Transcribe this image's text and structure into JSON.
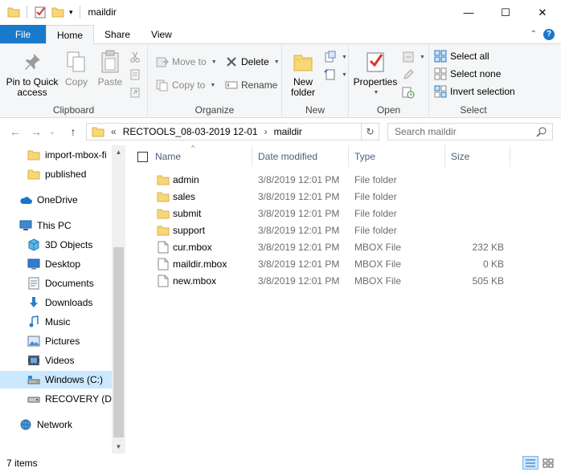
{
  "window": {
    "title": "maildir",
    "minimize": "—",
    "maximize": "☐",
    "close": "✕"
  },
  "tabs": [
    {
      "label": "File"
    },
    {
      "label": "Home"
    },
    {
      "label": "Share"
    },
    {
      "label": "View"
    }
  ],
  "ribbon": {
    "clipboard": {
      "label": "Clipboard",
      "pin_line1": "Pin to Quick",
      "pin_line2": "access",
      "copy": "Copy",
      "paste": "Paste"
    },
    "organize": {
      "label": "Organize",
      "move_to": "Move to",
      "copy_to": "Copy to",
      "delete": "Delete",
      "rename": "Rename"
    },
    "new": {
      "label": "New",
      "new_folder_line1": "New",
      "new_folder_line2": "folder"
    },
    "open": {
      "label": "Open",
      "properties": "Properties"
    },
    "select": {
      "label": "Select",
      "select_all": "Select all",
      "select_none": "Select none",
      "invert_selection": "Invert selection"
    }
  },
  "address": {
    "overflow": "«",
    "crumb1": "RECTOOLS_08-03-2019 12-01",
    "sep": "›",
    "crumb2": "maildir"
  },
  "search": {
    "placeholder": "Search maildir"
  },
  "nav": [
    {
      "label": "import-mbox-fi",
      "icon": "folder-icon"
    },
    {
      "label": "published",
      "icon": "folder-icon"
    },
    {
      "label": "OneDrive",
      "icon": "cloud-icon"
    },
    {
      "label": "This PC",
      "icon": "computer-icon"
    },
    {
      "label": "3D Objects",
      "icon": "cube-icon"
    },
    {
      "label": "Desktop",
      "icon": "desktop-icon"
    },
    {
      "label": "Documents",
      "icon": "documents-icon"
    },
    {
      "label": "Downloads",
      "icon": "download-icon"
    },
    {
      "label": "Music",
      "icon": "music-icon"
    },
    {
      "label": "Pictures",
      "icon": "pictures-icon"
    },
    {
      "label": "Videos",
      "icon": "videos-icon"
    },
    {
      "label": "Windows (C:)",
      "icon": "drive-icon"
    },
    {
      "label": "RECOVERY (D:)",
      "icon": "drive-icon"
    },
    {
      "label": "Network",
      "icon": "network-icon"
    }
  ],
  "columns": {
    "name": "Name",
    "date": "Date modified",
    "type": "Type",
    "size": "Size"
  },
  "files": [
    {
      "name": "admin",
      "date": "3/8/2019 12:01 PM",
      "type": "File folder",
      "size": "",
      "icon": "folder-icon"
    },
    {
      "name": "sales",
      "date": "3/8/2019 12:01 PM",
      "type": "File folder",
      "size": "",
      "icon": "folder-icon"
    },
    {
      "name": "submit",
      "date": "3/8/2019 12:01 PM",
      "type": "File folder",
      "size": "",
      "icon": "folder-icon"
    },
    {
      "name": "support",
      "date": "3/8/2019 12:01 PM",
      "type": "File folder",
      "size": "",
      "icon": "folder-icon"
    },
    {
      "name": "cur.mbox",
      "date": "3/8/2019 12:01 PM",
      "type": "MBOX File",
      "size": "232 KB",
      "icon": "file-icon"
    },
    {
      "name": "maildir.mbox",
      "date": "3/8/2019 12:01 PM",
      "type": "MBOX File",
      "size": "0 KB",
      "icon": "file-icon"
    },
    {
      "name": "new.mbox",
      "date": "3/8/2019 12:01 PM",
      "type": "MBOX File",
      "size": "505 KB",
      "icon": "file-icon"
    }
  ],
  "status": {
    "items": "7 items"
  },
  "colors": {
    "accent": "#1979ca",
    "folder": "#f8d775",
    "selected": "#cce8ff"
  }
}
